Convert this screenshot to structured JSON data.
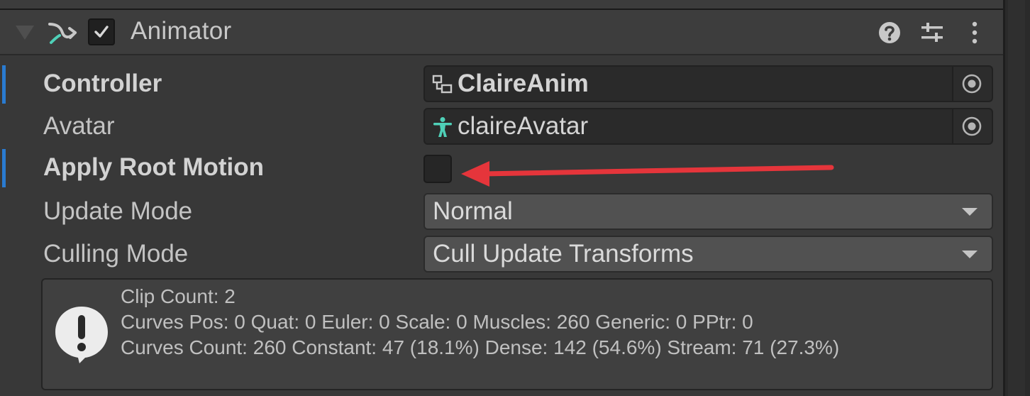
{
  "component": {
    "title": "Animator",
    "enabled": true
  },
  "properties": {
    "controller": {
      "label": "Controller",
      "value": "ClaireAnim"
    },
    "avatar": {
      "label": "Avatar",
      "value": "claireAvatar"
    },
    "apply_root_motion": {
      "label": "Apply Root Motion",
      "checked": false
    },
    "update_mode": {
      "label": "Update Mode",
      "value": "Normal"
    },
    "culling_mode": {
      "label": "Culling Mode",
      "value": "Cull Update Transforms"
    }
  },
  "info": {
    "lines": [
      "Clip Count: 2",
      "Curves Pos: 0 Quat: 0 Euler: 0 Scale: 0 Muscles: 260 Generic: 0 PPtr: 0",
      "Curves Count: 260 Constant: 47 (18.1%) Dense: 142 (54.6%) Stream: 71 (27.3%)"
    ]
  },
  "colors": {
    "override_indicator": "#2a7bd1",
    "annotation_arrow": "#e5353b",
    "avatar_icon": "#4fd0b8"
  },
  "icons": {
    "foldout": "foldout-expanded-icon",
    "component": "animator-icon",
    "help": "help-icon",
    "presets": "presets-icon",
    "menu": "kebab-menu-icon",
    "controller": "animator-controller-icon",
    "avatar": "avatar-icon",
    "picker": "object-picker-icon",
    "info": "info-exclamation-icon"
  }
}
